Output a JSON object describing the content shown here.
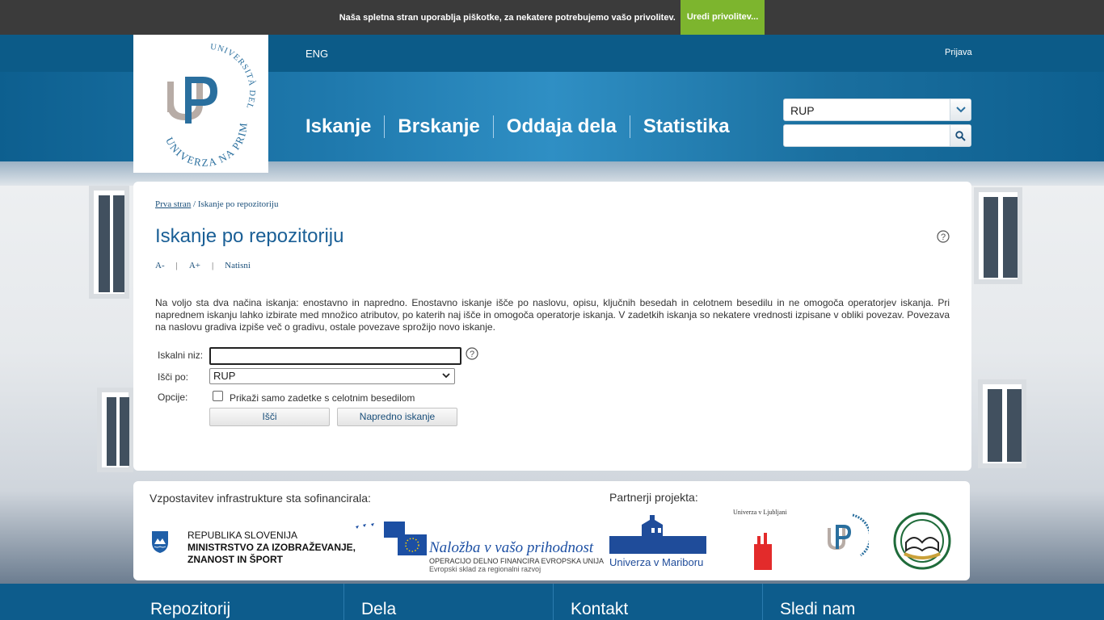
{
  "cookie": {
    "text": "Naša spletna stran uporablja piškotke, za nekatere potrebujemo vašo privolitev.",
    "button": "Uredi privolitev..."
  },
  "header": {
    "lang": "ENG",
    "login": "Prijava",
    "nav": [
      "Iskanje",
      "Brskanje",
      "Oddaja dela",
      "Statistika"
    ],
    "repo_select_value": "RUP",
    "search_placeholder": ""
  },
  "breadcrumb": {
    "home": "Prva stran",
    "separator": "/",
    "current": "Iskanje po repozitoriju"
  },
  "page": {
    "title": "Iskanje po repozitoriju",
    "tools": [
      "A-",
      "A+",
      "Natisni"
    ],
    "intro": "Na voljo sta dva načina iskanja: enostavno in napredno. Enostavno iskanje išče po naslovu, opisu, ključnih besedah in celotnem besedilu in ne omogoča operatorjev iskanja. Pri naprednem iskanju lahko izbirate med množico atributov, po katerih naj išče in omogoča operatorje iskanja. V zadetkih iskanja so nekatere vrednosti izpisane v obliki povezav. Povezava na naslovu gradiva izpiše več o gradivu, ostale povezave sprožijo novo iskanje."
  },
  "form": {
    "query_label": "Iskalni niz:",
    "query_value": "",
    "field_label": "Išči po:",
    "field_value": "RUP",
    "options_label": "Opcije:",
    "fulltext_only_label": "Prikaži samo zadetke s celotnim besedilom",
    "fulltext_only_checked": false,
    "search_button": "Išči",
    "advanced_button": "Napredno iskanje"
  },
  "sponsors": {
    "cofinanced_heading": "Vzpostavitev infrastrukture sta sofinancirala:",
    "partners_heading": "Partnerji projekta:",
    "ministry_lines": [
      "REPUBLIKA SLOVENIJA",
      "MINISTRSTVO ZA IZOBRAŽEVANJE,",
      "ZNANOST IN ŠPORT"
    ],
    "eu_slogan": "Naložba v vašo prihodnost",
    "eu_line1": "Operacijo delno financira Evropska unija",
    "eu_line2": "Evropski sklad za regionalni razvoj",
    "partner_maribor": "Univerza v Mariboru",
    "partner_ljubljana": "Univerza v Ljubljani"
  },
  "logo": {
    "ring_top": "UNIVERSITÀ DEL LITORALE",
    "ring_bottom": "UNIVERZA NA PRIMORSKEM"
  },
  "footer": {
    "columns": [
      "Repozitorij",
      "Dela",
      "Kontakt",
      "Sledi nam"
    ]
  },
  "colors": {
    "brand_blue": "#0d5c8c",
    "accent_green": "#7db52e",
    "title_blue": "#1a5f96"
  }
}
